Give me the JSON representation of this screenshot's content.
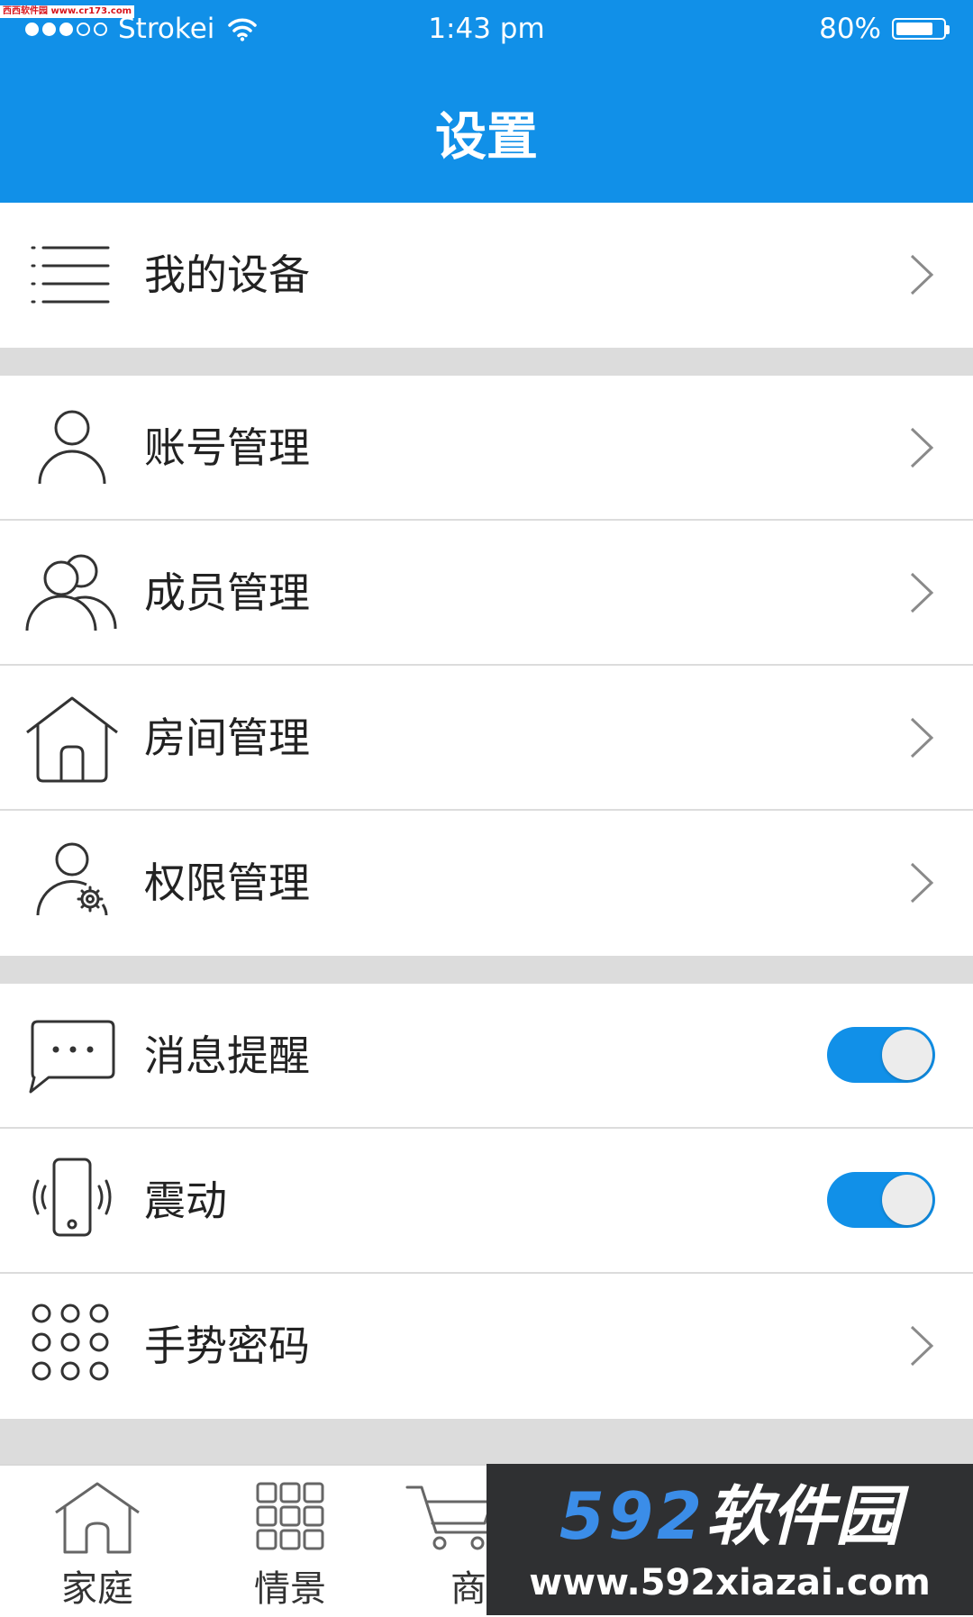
{
  "status_bar": {
    "carrier": "Strokei",
    "time": "1:43 pm",
    "battery_percent": "80%",
    "battery_level": 0.8,
    "signal_bars": 3,
    "signal_total": 5
  },
  "header": {
    "title": "设置"
  },
  "menu": {
    "my_devices": "我的设备",
    "account_mgmt": "账号管理",
    "member_mgmt": "成员管理",
    "room_mgmt": "房间管理",
    "permission_mgmt": "权限管理",
    "message_reminder": {
      "label": "消息提醒",
      "enabled": true
    },
    "vibration": {
      "label": "震动",
      "enabled": true
    },
    "gesture_password": "手势密码"
  },
  "tabbar": {
    "items": [
      {
        "label": "家庭"
      },
      {
        "label": "情景"
      },
      {
        "label": "商"
      }
    ]
  },
  "watermark": {
    "logo_num": "592",
    "logo_cn": "软件园",
    "url": "www.592xiazai.com",
    "corner_text": "西西软件园 www.cr173.com"
  },
  "colors": {
    "accent": "#1190e8",
    "divider": "#dcdcdc",
    "text": "#222222"
  }
}
